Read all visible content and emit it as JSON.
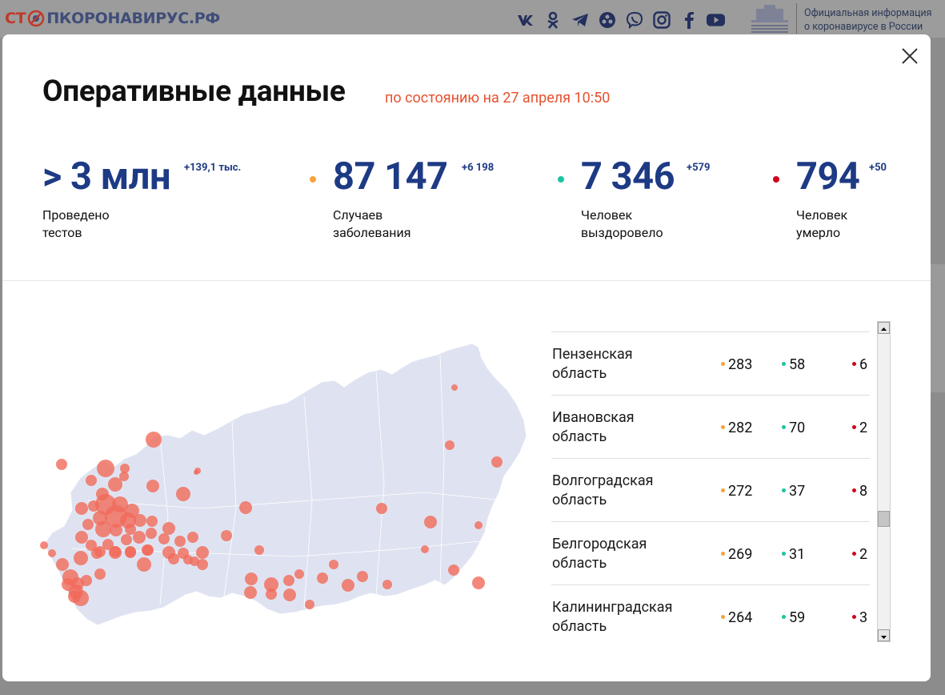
{
  "header": {
    "logo_part1": "СТ",
    "logo_part2": "ПКОРОНАВИРУС.РФ",
    "gov_text_line1": "Официальная информация",
    "gov_text_line2": "о коронавирусе в России",
    "socials": [
      "vk-icon",
      "odnoklassniki-icon",
      "telegram-icon",
      "social-circle-icon",
      "viber-icon",
      "instagram-icon",
      "facebook-icon",
      "youtube-icon"
    ]
  },
  "modal": {
    "title": "Оперативные данные",
    "subtitle": "по состоянию на 27 апреля 10:50",
    "stats": [
      {
        "value": "> 3 млн",
        "delta": "+139,1 тыс.",
        "label_line1": "Проведено",
        "label_line2": "тестов"
      },
      {
        "value": "87 147",
        "delta": "+6 198",
        "label_line1": "Случаев",
        "label_line2": "заболевания"
      },
      {
        "value": "7 346",
        "delta": "+579",
        "label_line1": "Человек",
        "label_line2": "выздоровело"
      },
      {
        "value": "794",
        "delta": "+50",
        "label_line1": "Человек",
        "label_line2": "умерло"
      }
    ],
    "regions": [
      {
        "name_line1": "Пензенская",
        "name_line2": "область",
        "cases": "283",
        "recovered": "58",
        "deaths": "6"
      },
      {
        "name_line1": "Ивановская",
        "name_line2": "область",
        "cases": "282",
        "recovered": "70",
        "deaths": "2"
      },
      {
        "name_line1": "Волгоградская",
        "name_line2": "область",
        "cases": "272",
        "recovered": "37",
        "deaths": "8"
      },
      {
        "name_line1": "Белгородская",
        "name_line2": "область",
        "cases": "269",
        "recovered": "31",
        "deaths": "2"
      },
      {
        "name_line1": "Калининградская",
        "name_line2": "область",
        "cases": "264",
        "recovered": "59",
        "deaths": "3"
      }
    ]
  },
  "colors": {
    "accent_blue": "#1d3a84",
    "cases": "#f7a23b",
    "recovered": "#1bc4a0",
    "deaths": "#d0021b",
    "subtitle": "#e6512f",
    "map_fill": "#dfe3f1",
    "map_bubble": "#f16a5a"
  }
}
